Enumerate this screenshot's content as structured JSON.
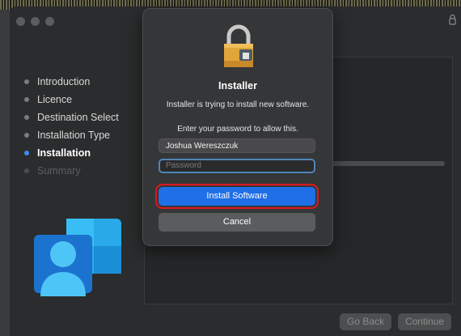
{
  "window": {
    "steps": [
      {
        "label": "Introduction",
        "state": "done"
      },
      {
        "label": "Licence",
        "state": "done"
      },
      {
        "label": "Destination Select",
        "state": "done"
      },
      {
        "label": "Installation Type",
        "state": "done"
      },
      {
        "label": "Installation",
        "state": "current"
      },
      {
        "label": "Summary",
        "state": "pending"
      }
    ],
    "buttons": {
      "go_back": "Go Back",
      "continue": "Continue"
    }
  },
  "dialog": {
    "title": "Installer",
    "message": "Installer is trying to install new software.",
    "prompt": "Enter your password to allow this.",
    "username_value": "Joshua Wereszczuk",
    "password_placeholder": "Password",
    "install_label": "Install Software",
    "cancel_label": "Cancel"
  },
  "icons": {
    "dialog_icon": "padlock-package-icon",
    "window_lock": "lock-icon",
    "app_icon": "company-portal-icon"
  },
  "colors": {
    "accent": "#1f6fe6",
    "highlight_outline": "#e0171d",
    "active_step_dot": "#3d8ef5"
  }
}
